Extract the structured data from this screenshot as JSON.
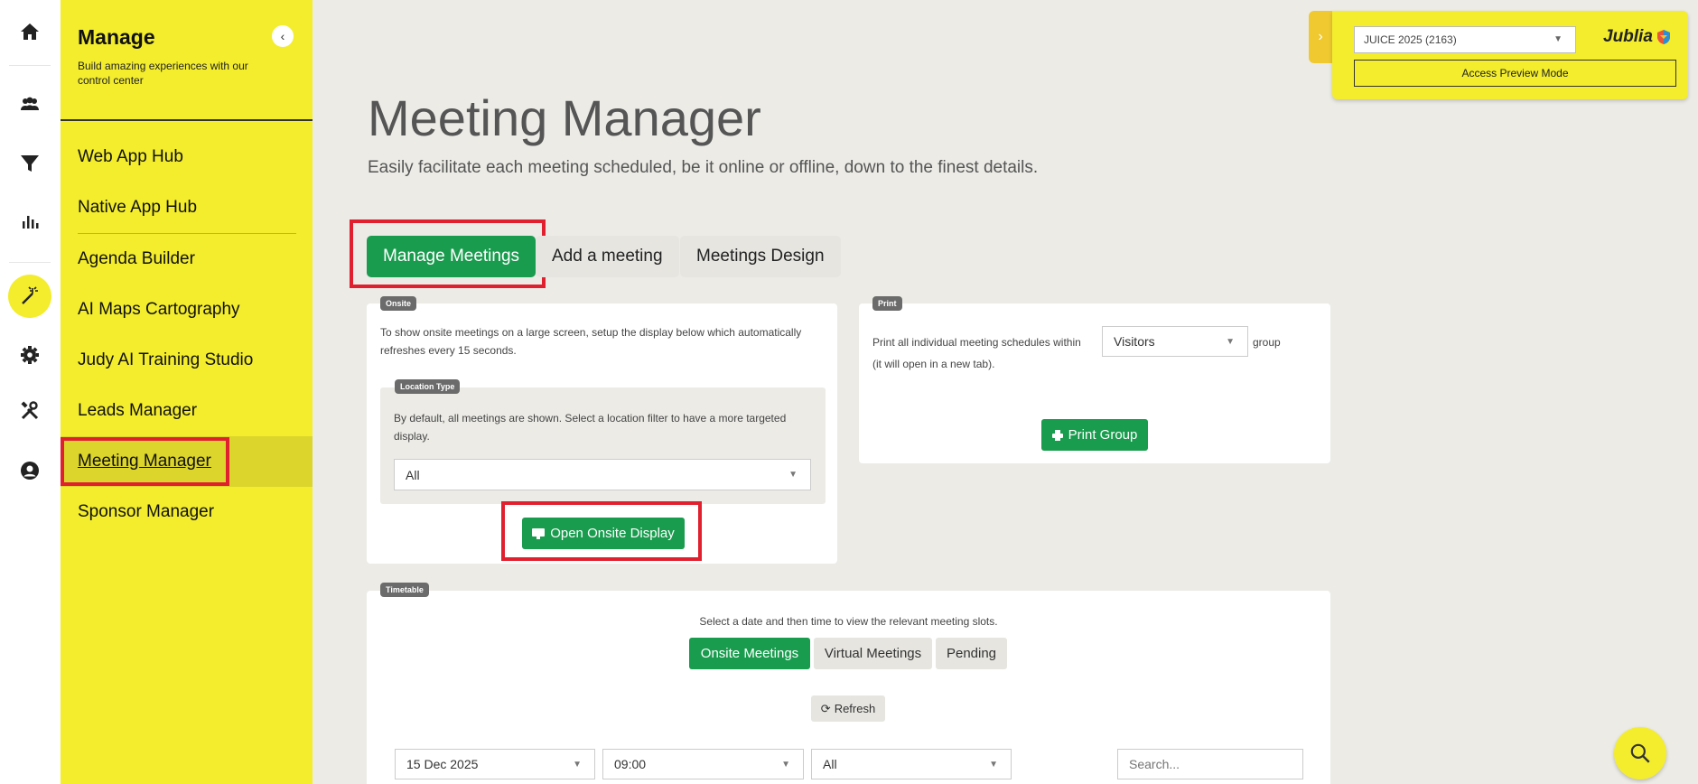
{
  "rail": {
    "icons": [
      "home-icon",
      "users-icon",
      "filter-icon",
      "chart-icon",
      "magic-wand-icon",
      "gear-icon",
      "tools-icon",
      "user-circle-icon"
    ]
  },
  "sidebar": {
    "title": "Manage",
    "subtitle": "Build amazing experiences with our control center",
    "items": [
      {
        "label": "Web App Hub"
      },
      {
        "label": "Native App Hub"
      },
      {
        "label": "Agenda Builder"
      },
      {
        "label": "AI Maps Cartography"
      },
      {
        "label": "Judy AI Training Studio"
      },
      {
        "label": "Leads Manager"
      },
      {
        "label": "Meeting Manager",
        "active": true
      },
      {
        "label": "Sponsor Manager"
      }
    ]
  },
  "top_panel": {
    "event_select": "JUICE 2025 (2163)",
    "brand": "Jublia",
    "preview_button": "Access Preview Mode"
  },
  "header": {
    "title": "Meeting Manager",
    "subtitle": "Easily facilitate each meeting scheduled, be it online or offline, down to the finest details."
  },
  "tabs": [
    {
      "label": "Manage Meetings",
      "active": true
    },
    {
      "label": "Add a meeting"
    },
    {
      "label": "Meetings Design"
    }
  ],
  "onsite": {
    "badge": "Onsite",
    "description": "To show onsite meetings on a large screen, setup the display below which automatically refreshes every 15 seconds.",
    "location_badge": "Location Type",
    "location_description": "By default, all meetings are shown. Select a location filter to have a more targeted display.",
    "location_value": "All",
    "open_button": "Open Onsite Display"
  },
  "print": {
    "badge": "Print",
    "text_before": "Print all individual meeting schedules within",
    "group_value": "Visitors",
    "text_after": "group",
    "note": "(it will open in a new tab).",
    "button": "Print Group"
  },
  "timetable": {
    "badge": "Timetable",
    "instruction": "Select a date and then time to view the relevant meeting slots.",
    "toggles": [
      {
        "label": "Onsite Meetings",
        "active": true
      },
      {
        "label": "Virtual Meetings"
      },
      {
        "label": "Pending"
      }
    ],
    "refresh": "Refresh",
    "date_value": "15 Dec 2025",
    "time_value": "09:00",
    "filter_value": "All",
    "search_placeholder": "Search..."
  },
  "colors": {
    "accent_yellow": "#f3ed2e",
    "primary_green": "#199c4e",
    "highlight_red": "#e0202e"
  }
}
